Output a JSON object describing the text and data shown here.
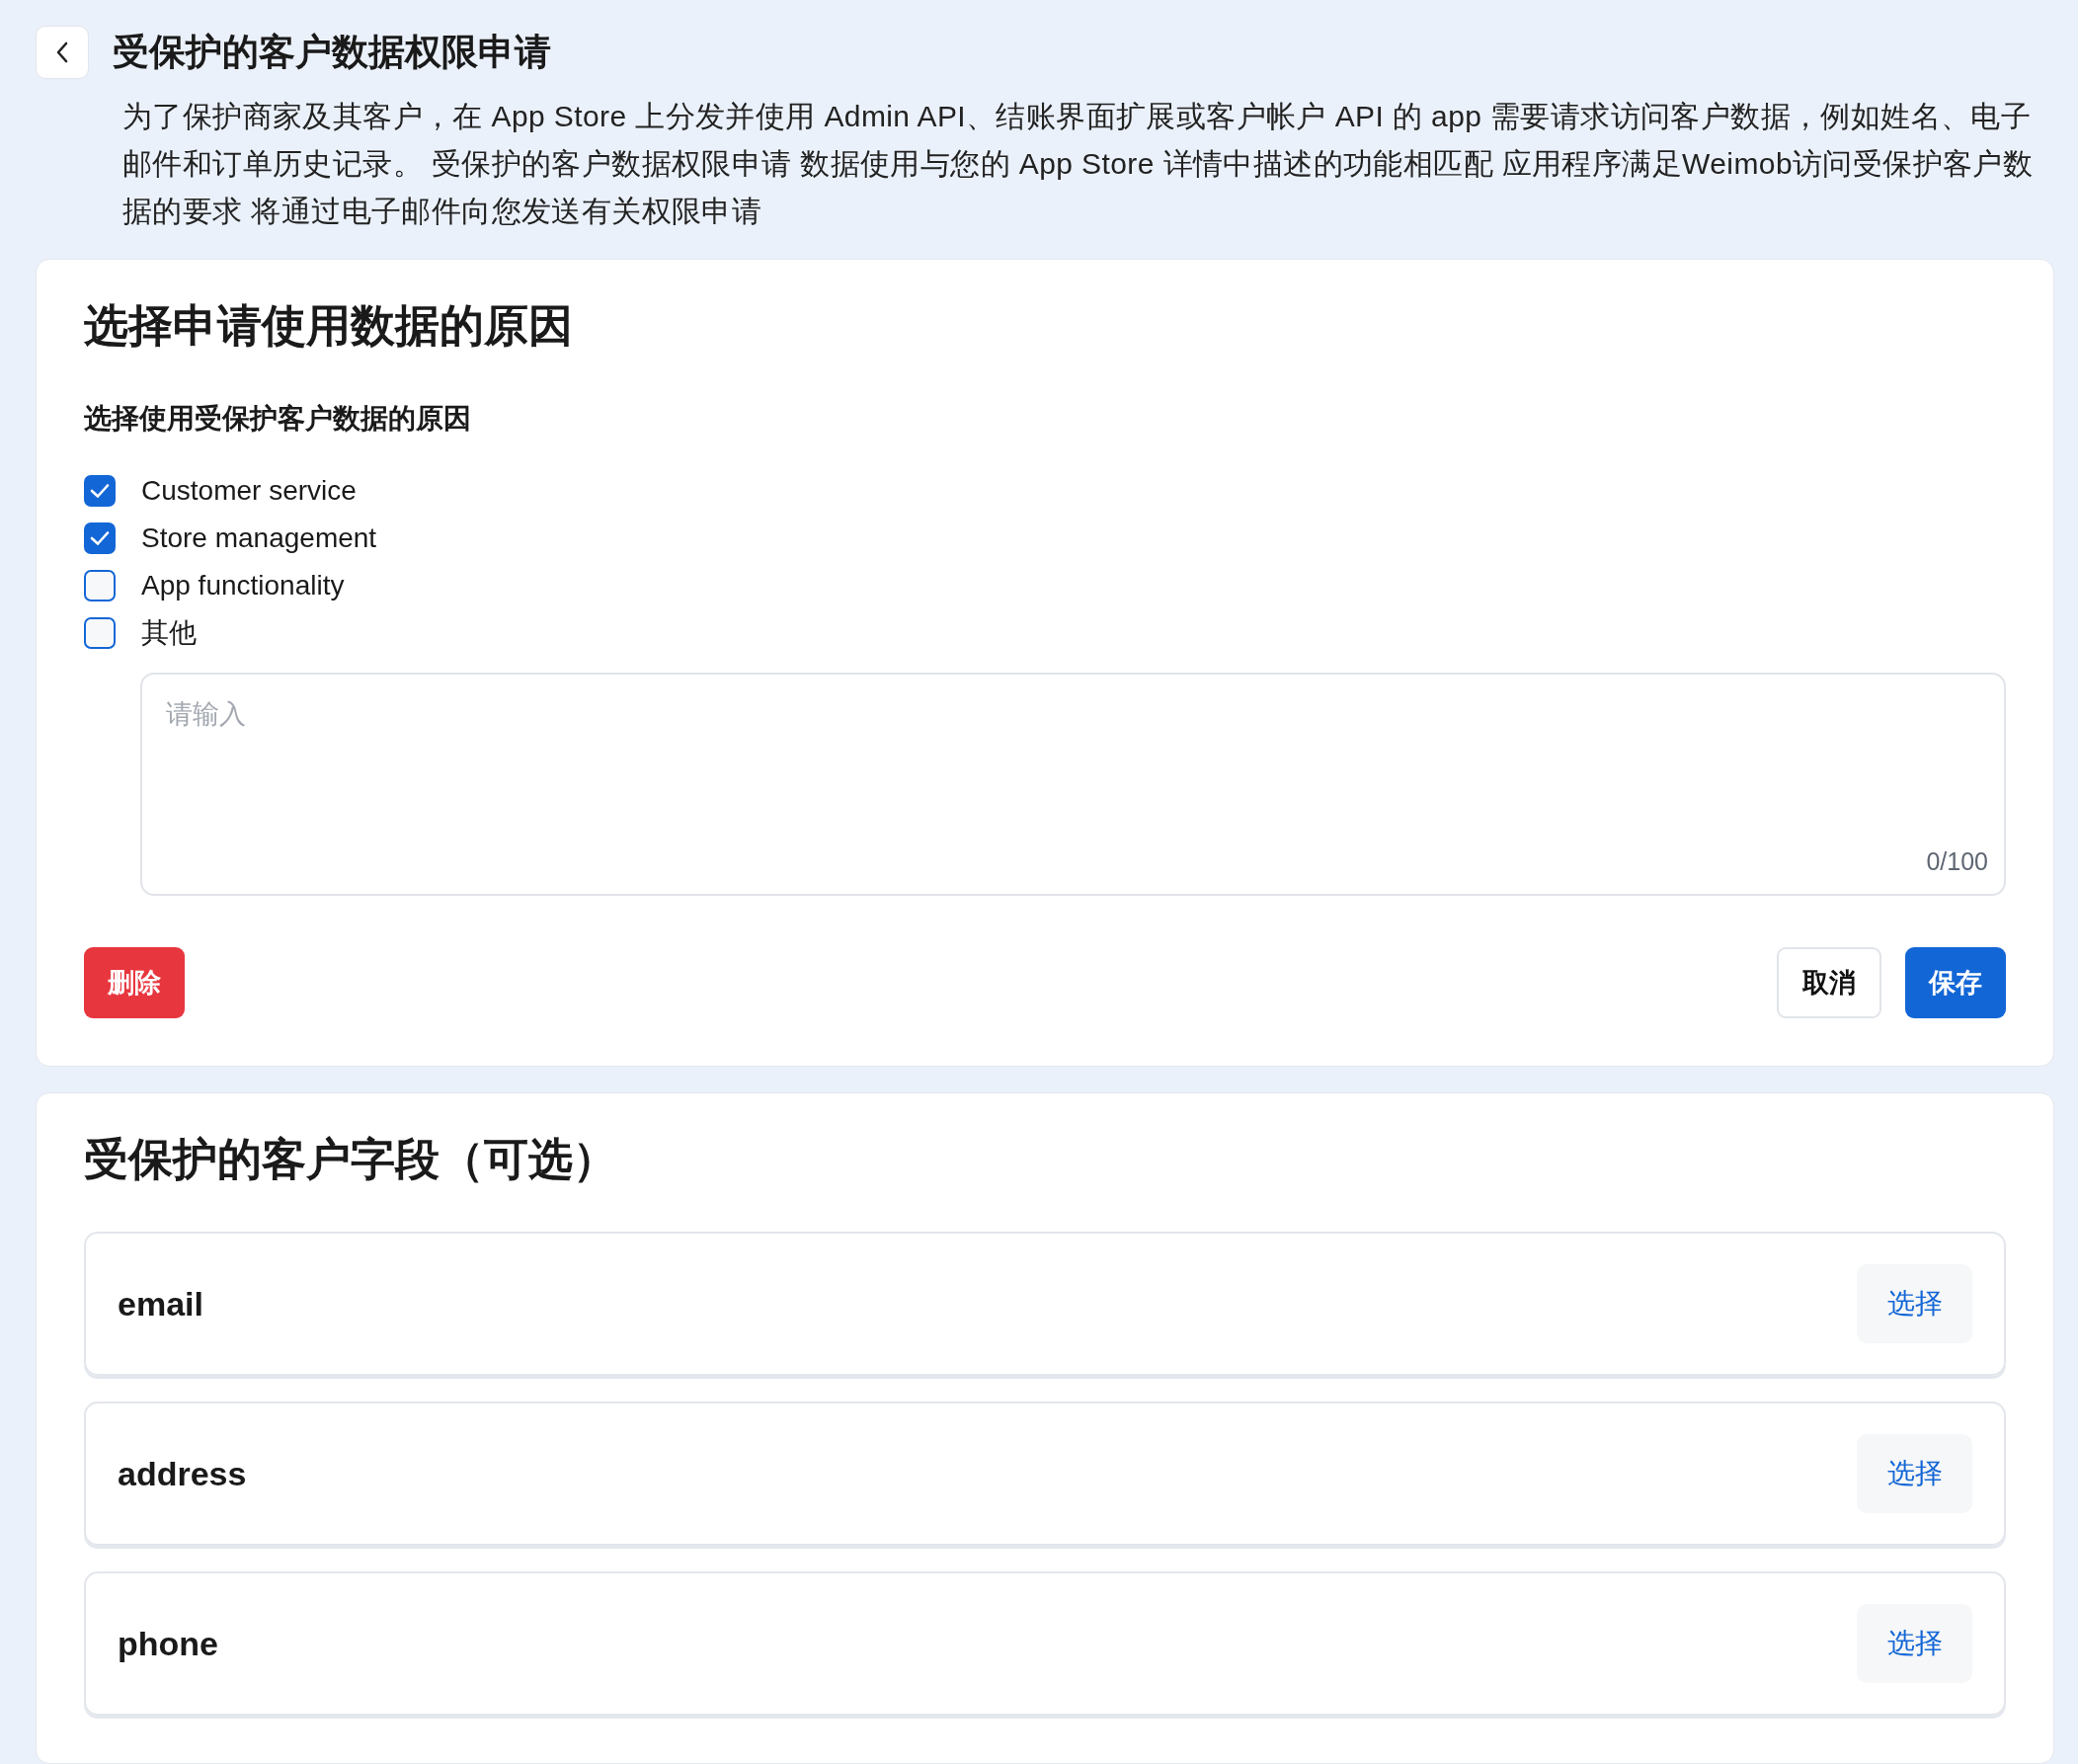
{
  "header": {
    "title": "受保护的客户数据权限申请",
    "description": "为了保护商家及其客户，在 App Store 上分发并使用 Admin API、结账界面扩展或客户帐户 API 的 app 需要请求访问客户数据，例如姓名、电子邮件和订单历史记录。 受保护的客户数据权限申请 数据使用与您的 App Store 详情中描述的功能相匹配 应用程序满足Weimob访问受保护客户数据的要求 将通过电子邮件向您发送有关权限申请"
  },
  "reason_card": {
    "title": "选择申请使用数据的原因",
    "subtitle": "选择使用受保护客户数据的原因",
    "reasons": [
      {
        "label": "Customer service",
        "checked": true
      },
      {
        "label": "Store management",
        "checked": true
      },
      {
        "label": "App functionality",
        "checked": false
      },
      {
        "label": "其他",
        "checked": false
      }
    ],
    "textarea": {
      "placeholder": "请输入",
      "counter": "0/100"
    },
    "buttons": [
      {
        "label": "删除",
        "kind": "danger"
      },
      {
        "label": "取消",
        "kind": "secondary"
      },
      {
        "label": "保存",
        "kind": "primary"
      }
    ]
  },
  "fields_card": {
    "title": "受保护的客户字段（可选）",
    "fields": [
      {
        "name": "email",
        "action": "选择"
      },
      {
        "name": "address",
        "action": "选择"
      },
      {
        "name": "phone",
        "action": "选择"
      }
    ]
  }
}
